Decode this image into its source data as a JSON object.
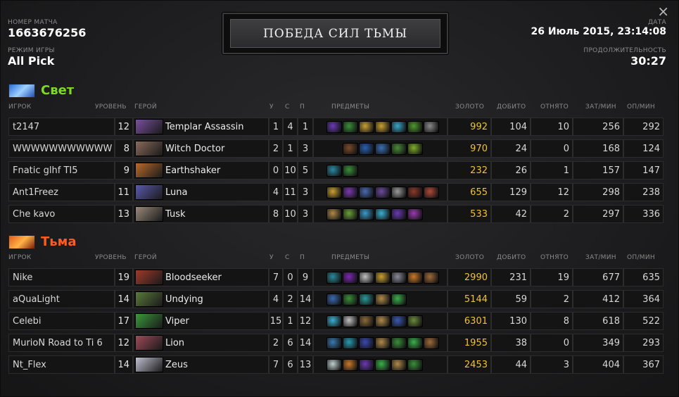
{
  "match": {
    "label": "НОМЕР МАТЧА",
    "id": "1663676256"
  },
  "mode": {
    "label": "РЕЖИМ ИГРЫ",
    "value": "All Pick"
  },
  "date": {
    "label": "ДАТА",
    "value": "26 Июль 2015, 23:14:08"
  },
  "duration": {
    "label": "ПРОДОЛЖИТЕЛЬНОСТЬ",
    "value": "30:27"
  },
  "banner": "ПОБЕДА СИЛ ТЬМЫ",
  "close_icon": "×",
  "columns": {
    "player": "ИГРОК",
    "level": "УРОВЕНЬ",
    "hero": "ГЕРОЙ",
    "k": "У",
    "d": "С",
    "a": "П",
    "items": "ПРЕДМЕТЫ",
    "gold": "ЗОЛОТО",
    "lh": "ДОБИТО",
    "dn": "ОТНЯТО",
    "xpm": "ЗАТ/МИН",
    "gpm": "ОП/МИН"
  },
  "colors": {
    "radiant": "#7ddb1f",
    "dire": "#ff5a1f",
    "gold": "#f1c232"
  },
  "radiant": {
    "name": "Свет",
    "players": [
      {
        "player": "t2147",
        "level": "12",
        "hero": "Templar Assassin",
        "hero_color": "#7a4fa0",
        "k": "1",
        "d": "4",
        "a": "1",
        "items": [
          "#6a3bb5",
          "#3b8f3a",
          "#c9a032",
          "#c9a032",
          "#3aa7c9",
          "#4f9a2e",
          "#8a8a8a"
        ],
        "gold": "992",
        "lh": "104",
        "dn": "10",
        "xpm": "256",
        "gpm": "292"
      },
      {
        "player": "WWWWWWWWWWW",
        "level": "8",
        "hero": "Witch Doctor",
        "hero_color": "#8a6a5a",
        "k": "2",
        "d": "1",
        "a": "3",
        "items": [
          "",
          "#7a4a2a",
          "#2a5fb0",
          "#3b6fb0",
          "#4a8a3a",
          "#7fae2a",
          ""
        ],
        "gold": "970",
        "lh": "24",
        "dn": "0",
        "xpm": "168",
        "gpm": "124"
      },
      {
        "player": "Fnatic glhf TI5",
        "level": "9",
        "hero": "Earthshaker",
        "hero_color": "#b86a2a",
        "k": "0",
        "d": "10",
        "a": "5",
        "items": [
          "#2a8aa0",
          "#3b8f3a",
          "",
          "",
          "",
          "",
          ""
        ],
        "gold": "232",
        "lh": "26",
        "dn": "1",
        "xpm": "157",
        "gpm": "147"
      },
      {
        "player": "Ant1Freez",
        "level": "11",
        "hero": "Luna",
        "hero_color": "#5a5ab0",
        "k": "4",
        "d": "11",
        "a": "3",
        "items": [
          "#c9a032",
          "#7a3ab0",
          "#4a6ab0",
          "#6a4a9a",
          "#9a9a9a",
          "#8a3a2a",
          "#b04a3a"
        ],
        "gold": "655",
        "lh": "129",
        "dn": "12",
        "xpm": "298",
        "gpm": "238"
      },
      {
        "player": "Che kavo",
        "level": "13",
        "hero": "Tusk",
        "hero_color": "#9a8a7a",
        "k": "8",
        "d": "10",
        "a": "3",
        "items": [
          "#b08a4a",
          "#6aa03a",
          "#3a9ac9",
          "#3ab0d0",
          "#6a3ab5",
          "#9a3ab0",
          ""
        ],
        "gold": "533",
        "lh": "42",
        "dn": "2",
        "xpm": "297",
        "gpm": "336"
      }
    ]
  },
  "dire": {
    "name": "Тьма",
    "players": [
      {
        "player": "Nike",
        "level": "19",
        "hero": "Bloodseeker",
        "hero_color": "#a03a2a",
        "k": "7",
        "d": "0",
        "a": "9",
        "items": [
          "#2a8a9a",
          "#7a2ab0",
          "#c0c0c0",
          "#c9a032",
          "#8a8a9a",
          "#c97a2a",
          "#a06a3a"
        ],
        "gold": "2990",
        "lh": "231",
        "dn": "19",
        "xpm": "677",
        "gpm": "635"
      },
      {
        "player": "aQuaLight",
        "level": "14",
        "hero": "Undying",
        "hero_color": "#5a7a3a",
        "k": "4",
        "d": "2",
        "a": "14",
        "items": [
          "#3a6ab0",
          "#3b8f3a",
          "#2a9a9a",
          "#b08a4a",
          "#3ab04a",
          "",
          ""
        ],
        "gold": "5144",
        "lh": "59",
        "dn": "2",
        "xpm": "412",
        "gpm": "364"
      },
      {
        "player": "Celebi",
        "level": "17",
        "hero": "Viper",
        "hero_color": "#3a9a3a",
        "k": "15",
        "d": "1",
        "a": "12",
        "items": [
          "#3ab0d0",
          "#c0c0c0",
          "#8a6a3a",
          "#b08a4a",
          "#3a5ab0",
          "#6a8a3a",
          ""
        ],
        "gold": "6301",
        "lh": "130",
        "dn": "8",
        "xpm": "618",
        "gpm": "522"
      },
      {
        "player": "MurioN Road to Ti 6",
        "level": "12",
        "hero": "Lion",
        "hero_color": "#a04a5a",
        "k": "2",
        "d": "6",
        "a": "14",
        "items": [
          "#3a7ab0",
          "#2a9ab0",
          "#3a4ab0",
          "#b08a4a",
          "#3b8f3a",
          "#3ab04a",
          "#a06a3a"
        ],
        "gold": "1955",
        "lh": "38",
        "dn": "0",
        "xpm": "349",
        "gpm": "293"
      },
      {
        "player": "Nt_Flex",
        "level": "14",
        "hero": "Zeus",
        "hero_color": "#c0c0d0",
        "k": "7",
        "d": "6",
        "a": "13",
        "items": [
          "#c0d0d0",
          "#c97a2a",
          "#6a3ab0",
          "#3ab04a",
          "#b08a4a",
          "#3b8f3a",
          ""
        ],
        "gold": "2453",
        "lh": "44",
        "dn": "3",
        "xpm": "404",
        "gpm": "367"
      }
    ]
  }
}
